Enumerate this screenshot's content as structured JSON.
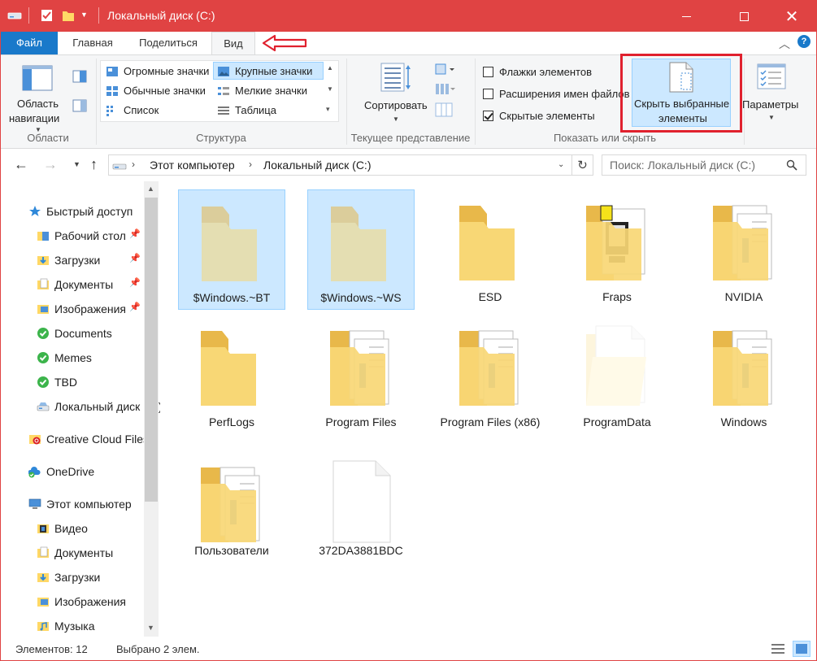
{
  "window": {
    "title": "Локальный диск (C:)",
    "accent": "#e04343"
  },
  "ribbon": {
    "tabs": [
      "Файл",
      "Главная",
      "Поделиться",
      "Вид"
    ],
    "active_tab": "Вид",
    "groups": {
      "panes": {
        "label": "Области",
        "nav_pane_line1": "Область",
        "nav_pane_line2": "навигации"
      },
      "layout": {
        "label": "Структура",
        "items": [
          "Огромные значки",
          "Крупные значки",
          "Обычные значки",
          "Мелкие значки",
          "Список",
          "Таблица"
        ],
        "selected": "Крупные значки"
      },
      "current_view": {
        "label": "Текущее представление",
        "sort_label": "Сортировать"
      },
      "show_hide": {
        "label": "Показать или скрыть",
        "checkboxes": [
          {
            "label": "Флажки элементов",
            "checked": false
          },
          {
            "label": "Расширения имен файлов",
            "checked": false
          },
          {
            "label": "Скрытые элементы",
            "checked": true
          }
        ],
        "hide_selected_line1": "Скрыть выбранные",
        "hide_selected_line2": "элементы"
      },
      "options": {
        "label": "Параметры"
      }
    }
  },
  "address": {
    "path": [
      "Этот компьютер",
      "Локальный диск (C:)"
    ],
    "search_placeholder": "Поиск: Локальный диск (C:)"
  },
  "nav": {
    "quick_access": "Быстрый доступ",
    "quick_items": [
      "Рабочий стол",
      "Загрузки",
      "Документы",
      "Изображения",
      "Documents",
      "Memes",
      "TBD",
      "Локальный диск (C:)"
    ],
    "creative_cloud": "Creative Cloud Files",
    "onedrive": "OneDrive",
    "this_pc": "Этот компьютер",
    "pc_items": [
      "Видео",
      "Документы",
      "Загрузки",
      "Изображения",
      "Музыка"
    ]
  },
  "files": [
    {
      "name": "$Windows.~BT",
      "type": "folder-empty",
      "selected": true,
      "hidden": true
    },
    {
      "name": "$Windows.~WS",
      "type": "folder-empty",
      "selected": true,
      "hidden": true
    },
    {
      "name": "ESD",
      "type": "folder-empty",
      "selected": false,
      "hidden": false
    },
    {
      "name": "Fraps",
      "type": "folder-fraps",
      "selected": false,
      "hidden": false
    },
    {
      "name": "NVIDIA",
      "type": "folder-docs",
      "selected": false,
      "hidden": false
    },
    {
      "name": "PerfLogs",
      "type": "folder-empty",
      "selected": false,
      "hidden": false
    },
    {
      "name": "Program Files",
      "type": "folder-docs",
      "selected": false,
      "hidden": false
    },
    {
      "name": "Program Files (x86)",
      "type": "folder-docs",
      "selected": false,
      "hidden": false
    },
    {
      "name": "ProgramData",
      "type": "folder-hidden",
      "selected": false,
      "hidden": true
    },
    {
      "name": "Windows",
      "type": "folder-docs",
      "selected": false,
      "hidden": false
    },
    {
      "name": "Пользователи",
      "type": "folder-docs",
      "selected": false,
      "hidden": false
    },
    {
      "name": "372DA3881BDC",
      "type": "file",
      "selected": false,
      "hidden": false
    }
  ],
  "status": {
    "items_count": "Элементов: 12",
    "selected_count": "Выбрано 2 элем."
  }
}
